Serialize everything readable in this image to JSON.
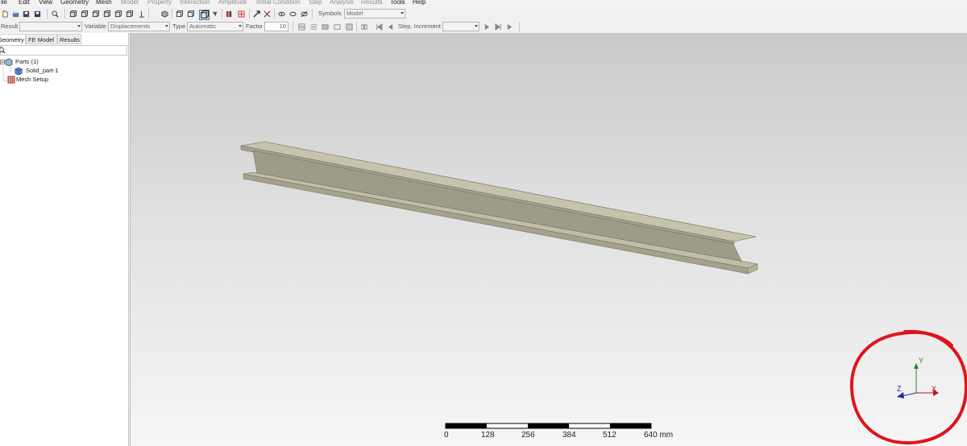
{
  "menubar": {
    "items": [
      {
        "label": "ile",
        "enabled": true
      },
      {
        "label": "Edit",
        "enabled": true
      },
      {
        "label": "View",
        "enabled": true
      },
      {
        "label": "Geometry",
        "enabled": true
      },
      {
        "label": "Mesh",
        "enabled": true
      },
      {
        "label": "Model",
        "enabled": false
      },
      {
        "label": "Property",
        "enabled": false
      },
      {
        "label": "Interaction",
        "enabled": false
      },
      {
        "label": "Amplitude",
        "enabled": false
      },
      {
        "label": "Initial Condition",
        "enabled": false
      },
      {
        "label": "Step",
        "enabled": false
      },
      {
        "label": "Analysis",
        "enabled": false
      },
      {
        "label": "Results",
        "enabled": false
      },
      {
        "label": "Tools",
        "enabled": true
      },
      {
        "label": "Help",
        "enabled": true
      }
    ]
  },
  "toolbar1": {
    "symbols_label": "Symbols",
    "symbols_value": "Model"
  },
  "toolbar2": {
    "result_label": "Result",
    "result_value": "",
    "variable_label": "Variable",
    "variable_value": "Displacements",
    "type_label": "Type",
    "type_value": "Automatic",
    "factor_label": "Factor",
    "factor_value": "10",
    "step_increment_label": "Step, Increment",
    "step_increment_value": ""
  },
  "left_panel": {
    "tabs": [
      {
        "label": "Geometry",
        "active": true
      },
      {
        "label": "FE Model",
        "active": false
      },
      {
        "label": "Results",
        "active": false
      }
    ],
    "search_value": "",
    "tree": {
      "parts_label": "Parts (1)",
      "part_label": "Solid_part-1",
      "mesh_label": "Mesh Setup"
    }
  },
  "viewport": {
    "model": "I-beam",
    "axes": {
      "x": "X",
      "y": "Y",
      "z": "Z"
    },
    "scale_bar": {
      "ticks": [
        "0",
        "128",
        "256",
        "384",
        "512",
        "640 mm"
      ]
    },
    "annotation_color": "#e0141b"
  },
  "colors": {
    "beam_top": "#c6c3ad",
    "beam_web": "#9e9c86",
    "beam_edge": "#6b6a5c",
    "axis_x": "#b11a1a",
    "axis_y": "#1f8a1f",
    "axis_z": "#1f2d9a"
  }
}
